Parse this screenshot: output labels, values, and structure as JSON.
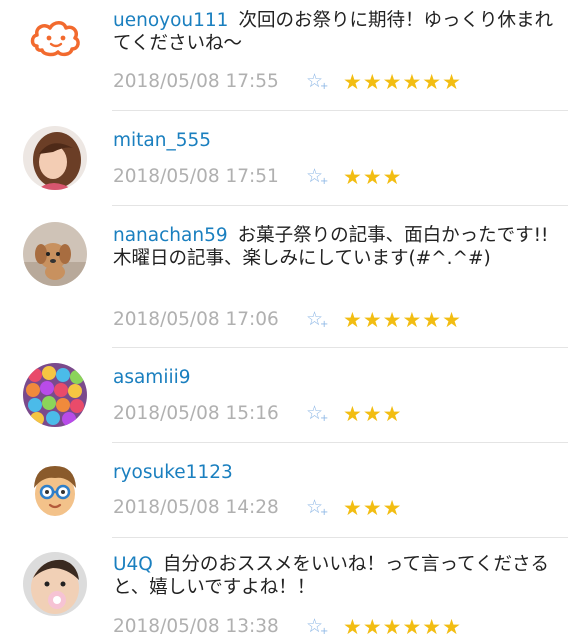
{
  "comments": [
    {
      "user": "uenoyou111",
      "text": "次回のお祭りに期待！ゆっくり休まれてくださいね〜",
      "date": "2018/05/08 17:55",
      "stars": "★★★★★★",
      "avatar": "mascot-icon"
    },
    {
      "user": "mitan_555",
      "text": "",
      "date": "2018/05/08 17:51",
      "stars": "★★★",
      "avatar": "woman-photo"
    },
    {
      "user": "nanachan59",
      "text": "お菓子祭りの記事、面白かったです!!　木曜日の記事、楽しみにしています(#^.^#)",
      "date": "2018/05/08 17:06",
      "stars": "★★★★★★",
      "avatar": "dog-photo"
    },
    {
      "user": "asamiii9",
      "text": "",
      "date": "2018/05/08 15:16",
      "stars": "★★★",
      "avatar": "colorful-balls-photo"
    },
    {
      "user": "ryosuke1123",
      "text": "",
      "date": "2018/05/08 14:28",
      "stars": "★★★",
      "avatar": "glasses-boy-icon"
    },
    {
      "user": "U4Q",
      "text": "自分のおススメをいいね！って言ってくださると、嬉しいですよね！！",
      "date": "2018/05/08 13:38",
      "stars": "★★★★★★",
      "avatar": "baby-photo"
    }
  ],
  "add_star": {
    "symbol": "☆",
    "plus": "+"
  },
  "colors": {
    "username": "#1a7fbf",
    "date": "#b0b0b0",
    "star": "#f2bd12",
    "add_star": "#8fb8e6",
    "separator": "#e4e4e4"
  }
}
